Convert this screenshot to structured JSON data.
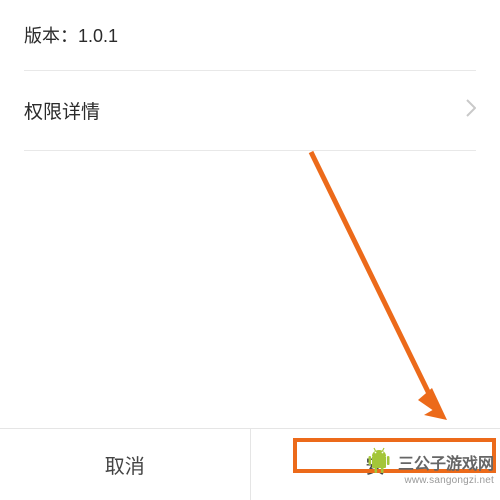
{
  "info": {
    "version_label": "版本：1.0.1",
    "permission_details_label": "权限详情"
  },
  "buttons": {
    "cancel": "取消",
    "install": "安"
  },
  "watermark": {
    "title": "三公子游戏网",
    "url": "www.sangongzi.net"
  },
  "colors": {
    "accent": "#ec6a1a",
    "android_green": "#a4c639"
  }
}
